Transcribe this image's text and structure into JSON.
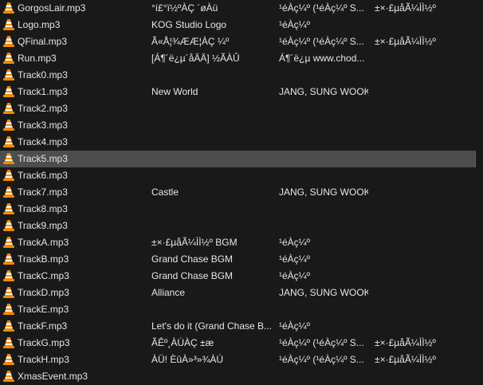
{
  "file_list": {
    "rows": [
      {
        "name": "GorgosLair.mp3",
        "title": "°í£°ï½ºÀÇ ´øÀü",
        "artist": "¹éÀç¼º (¹éÀç¼º S...",
        "album": "±×·£µåÃ¼ÌÌ½º"
      },
      {
        "name": "Logo.mp3",
        "title": "KOG Studio Logo",
        "artist": "¹éÀç¼º",
        "album": ""
      },
      {
        "name": "QFinal.mp3",
        "title": "Ã«Å¦¾ÆÆ¦ÀÇ ¼º",
        "artist": "¹éÀç¼º (¹éÀç¼º S...",
        "album": "±×·£µåÃ¼ÌÌ½º"
      },
      {
        "name": "Run.mp3",
        "title": "[Á¶´ë¿µ´åÄÄ] ½ÃÀÛ",
        "artist": "Á¶´ë¿µ www.chod...",
        "album": ""
      },
      {
        "name": "Track0.mp3",
        "title": "",
        "artist": "",
        "album": ""
      },
      {
        "name": "Track1.mp3",
        "title": "New World",
        "artist": "JANG, SUNG WOOK",
        "album": ""
      },
      {
        "name": "Track2.mp3",
        "title": "",
        "artist": "",
        "album": ""
      },
      {
        "name": "Track3.mp3",
        "title": "",
        "artist": "",
        "album": ""
      },
      {
        "name": "Track4.mp3",
        "title": "",
        "artist": "",
        "album": ""
      },
      {
        "name": "Track5.mp3",
        "title": "",
        "artist": "",
        "album": "",
        "selected": true
      },
      {
        "name": "Track6.mp3",
        "title": "",
        "artist": "",
        "album": ""
      },
      {
        "name": "Track7.mp3",
        "title": "Castle",
        "artist": "JANG, SUNG WOOK",
        "album": ""
      },
      {
        "name": "Track8.mp3",
        "title": "",
        "artist": "",
        "album": ""
      },
      {
        "name": "Track9.mp3",
        "title": "",
        "artist": "",
        "album": ""
      },
      {
        "name": "TrackA.mp3",
        "title": "±×·£µåÃ¼ÌÌ½º BGM",
        "artist": "¹éÀç¼º",
        "album": ""
      },
      {
        "name": "TrackB.mp3",
        "title": "Grand Chase BGM",
        "artist": "¹éÀç¼º",
        "album": ""
      },
      {
        "name": "TrackC.mp3",
        "title": "Grand Chase BGM",
        "artist": "¹éÀç¼º",
        "album": ""
      },
      {
        "name": "TrackD.mp3",
        "title": "Alliance",
        "artist": "JANG, SUNG WOOK",
        "album": ""
      },
      {
        "name": "TrackE.mp3",
        "title": "",
        "artist": "",
        "album": ""
      },
      {
        "name": "TrackF.mp3",
        "title": "Let's do it (Grand Chase B...",
        "artist": "¹éÀç¼º",
        "album": ""
      },
      {
        "name": "TrackG.mp3",
        "title": "ÃÊº¸ÀÚÀÇ ±æ",
        "artist": "¹éÀç¼º (¹éÀç¼º S...",
        "album": "±×·£µåÃ¼ÌÌ½º"
      },
      {
        "name": "TrackH.mp3",
        "title": "ÀÜ! ÈûÀ»³»¾ÀÚ",
        "artist": "¹éÀç¼º (¹éÀç¼º S...",
        "album": "±×·£µåÃ¼ÌÌ½º"
      },
      {
        "name": "XmasEvent.mp3",
        "title": "",
        "artist": "",
        "album": ""
      }
    ]
  },
  "icons": {
    "file_icon": "vlc-cone-icon"
  },
  "colors": {
    "background": "#191919",
    "text": "#e6e6e6",
    "selected_row": "#4d4d4d",
    "cone_orange": "#f08a00",
    "cone_white": "#f4f4f4"
  }
}
